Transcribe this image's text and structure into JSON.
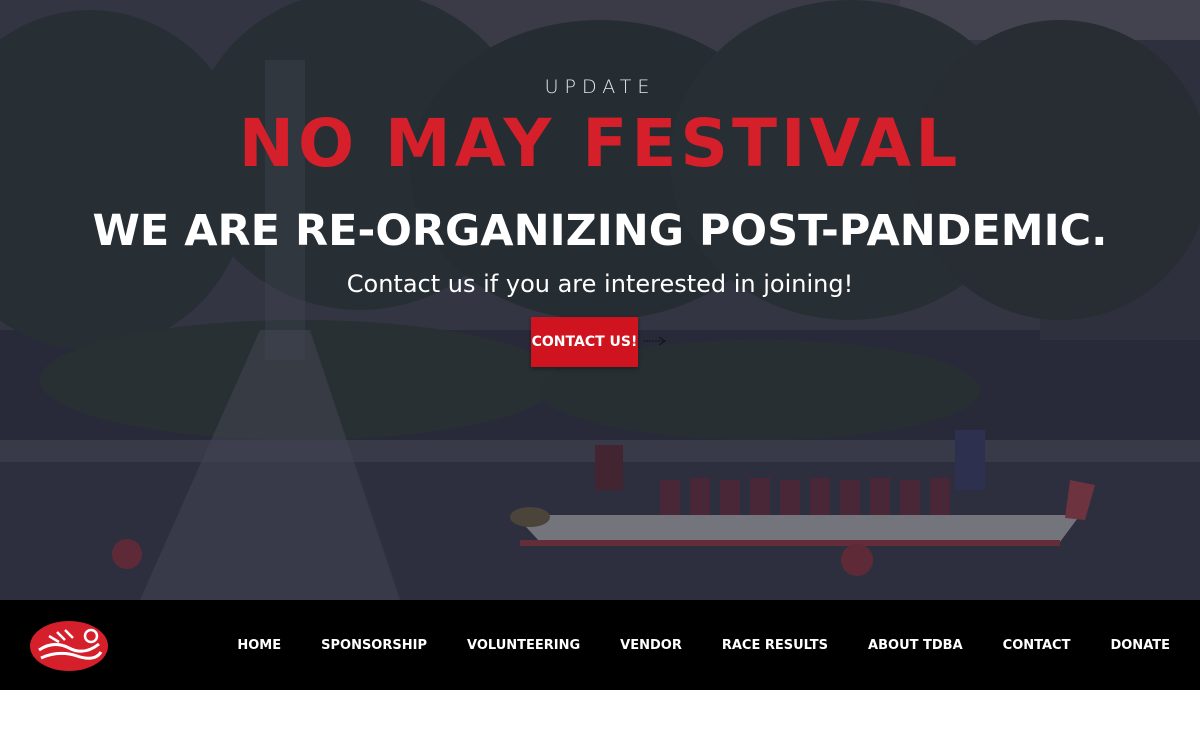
{
  "hero": {
    "eyebrow": "UPDATE",
    "headline": "NO MAY FESTIVAL",
    "subhead": "WE ARE RE-ORGANIZING POST-PANDEMIC.",
    "lead": "Contact us if you are interested in joining!",
    "cta_label": "CONTACT US!",
    "cta_arrow_icon": "arrow-right-icon",
    "background_image": "dragon boat racing on a lake with fountain"
  },
  "nav": {
    "logo_icon": "dragon-boat-logo-icon",
    "items": [
      {
        "label": "HOME"
      },
      {
        "label": "SPONSORSHIP"
      },
      {
        "label": "VOLUNTEERING"
      },
      {
        "label": "VENDOR"
      },
      {
        "label": "RACE RESULTS"
      },
      {
        "label": "ABOUT TDBA"
      },
      {
        "label": "CONTACT"
      },
      {
        "label": "DONATE"
      }
    ]
  },
  "colors": {
    "accent_red": "#d51f2a",
    "button_red": "#d0141f",
    "nav_bg": "#000000",
    "hero_overlay": "#232434"
  }
}
